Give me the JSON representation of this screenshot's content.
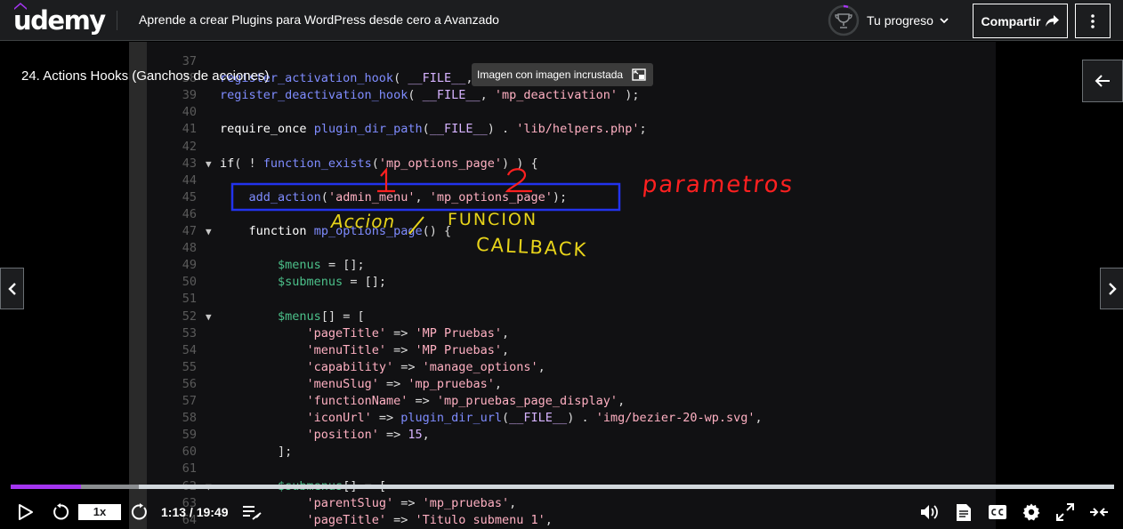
{
  "header": {
    "logo": "udemy",
    "course_title": "Aprende a crear Plugins para WordPress desde cero a Avanzado",
    "progress_label": "Tu progreso",
    "progress_fraction": 0.05,
    "share_label": "Compartir",
    "icons": {
      "progress": "trophy-icon",
      "chevron": "chevron-down-icon",
      "share": "share-arrow-icon",
      "more": "vertical-ellipsis-icon"
    }
  },
  "player": {
    "lesson_title": "24. Actions Hooks (Ganchos de acciones)",
    "pip_tooltip": "Imagen con imagen incrustada",
    "rate": "1x",
    "time": "1:13 / 19:49",
    "progress_fraction": 0.0638,
    "buffer_fraction": 1.0,
    "accent": "#a435f0",
    "icons": [
      "play-icon",
      "rewind-icon",
      "forward-icon",
      "playlist-icon",
      "volume-icon",
      "transcript-icon",
      "captions-icon",
      "settings-icon",
      "fullscreen-icon",
      "collapse-icon"
    ]
  },
  "code": {
    "lines": [
      {
        "n": "37",
        "text": ""
      },
      {
        "n": "38",
        "text": "register_activation_hook( __FILE__, 'mp_activation' );"
      },
      {
        "n": "39",
        "text": "register_deactivation_hook( __FILE__, 'mp_deactivation' );"
      },
      {
        "n": "40",
        "text": ""
      },
      {
        "n": "41",
        "text": "require_once plugin_dir_path(__FILE__) . 'lib/helpers.php';"
      },
      {
        "n": "42",
        "text": ""
      },
      {
        "n": "43",
        "text": "if( ! function_exists('mp_options_page') ) {"
      },
      {
        "n": "44",
        "text": ""
      },
      {
        "n": "45",
        "text": "    add_action('admin_menu', 'mp_options_page');"
      },
      {
        "n": "46",
        "text": ""
      },
      {
        "n": "47",
        "text": "    function mp_options_page() {"
      },
      {
        "n": "48",
        "text": ""
      },
      {
        "n": "49",
        "text": "        $menus = [];"
      },
      {
        "n": "50",
        "text": "        $submenus = [];"
      },
      {
        "n": "51",
        "text": ""
      },
      {
        "n": "52",
        "text": "        $menus[] = ["
      },
      {
        "n": "53",
        "text": "            'pageTitle' => 'MP Pruebas',"
      },
      {
        "n": "54",
        "text": "            'menuTitle' => 'MP Pruebas',"
      },
      {
        "n": "55",
        "text": "            'capability' => 'manage_options',"
      },
      {
        "n": "56",
        "text": "            'menuSlug' => 'mp_pruebas',"
      },
      {
        "n": "57",
        "text": "            'functionName' => 'mp_pruebas_page_display',"
      },
      {
        "n": "58",
        "text": "            'iconUrl' => plugin_dir_url(__FILE__) . 'img/bezier-20-wp.svg',"
      },
      {
        "n": "59",
        "text": "            'position' => 15,"
      },
      {
        "n": "60",
        "text": "        ];"
      },
      {
        "n": "61",
        "text": ""
      },
      {
        "n": "62",
        "text": "        $submenus[] = ["
      },
      {
        "n": "63",
        "text": "            'parentSlug' => 'mp_pruebas',"
      },
      {
        "n": "64",
        "text": "            'pageTitle' => 'Titulo submenu 1',"
      }
    ]
  },
  "annotations": {
    "numbers": [
      "1",
      "2"
    ],
    "parametros": "parametros",
    "accion": "Accion",
    "funcion": "FUNCION",
    "callback": "CALLBACK"
  }
}
